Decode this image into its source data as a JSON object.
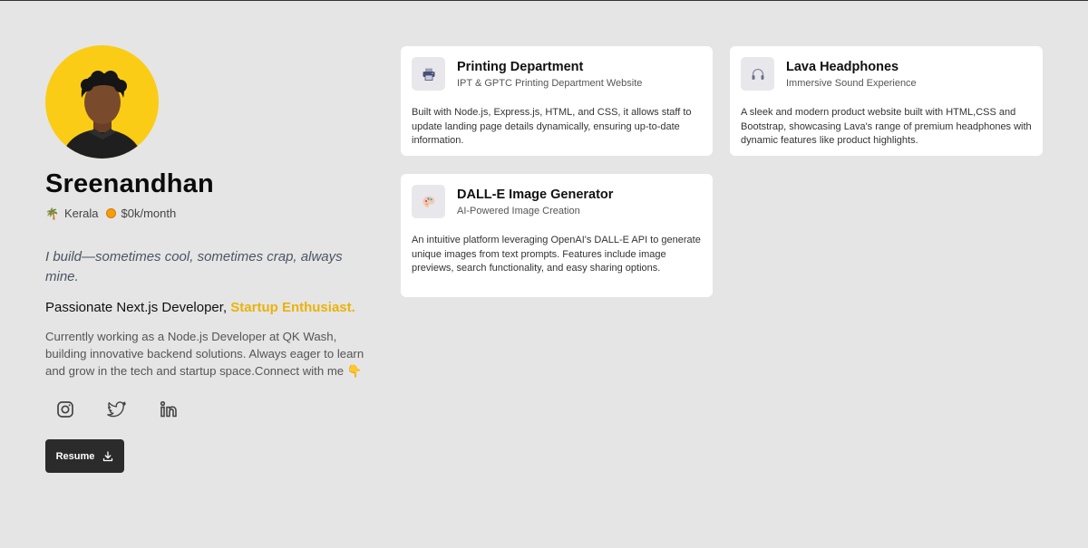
{
  "profile": {
    "name": "Sreenandhan",
    "location_emoji": "🌴",
    "location": "Kerala",
    "income": "$0k/month",
    "tagline": "I build—sometimes cool, sometimes crap, always mine.",
    "role_prefix": "Passionate Next.js Developer,",
    "role_accent": "Startup Enthusiast.",
    "bio": "Currently working as a Node.js Developer at QK Wash, building innovative backend solutions. Always eager to learn and grow in the tech and startup space.Connect with me 👇",
    "socials": [
      "instagram-icon",
      "twitter-icon",
      "linkedin-icon"
    ],
    "resume_label": "Resume",
    "accent_color": "#eab308",
    "avatar_bg": "#facc15"
  },
  "projects": [
    {
      "title": "Printing Department",
      "subtitle": "IPT & GPTC Printing Department Website",
      "description": "Built with Node.js, Express.js, HTML, and CSS, it allows staff to update landing page details dynamically, ensuring up-to-date information.",
      "icon": "printer-icon"
    },
    {
      "title": "Lava Headphones",
      "subtitle": "Immersive Sound Experience",
      "description": "A sleek and modern product website built with HTML,CSS and Bootstrap, showcasing Lava's range of premium headphones with dynamic features like product highlights.",
      "icon": "headphones-icon"
    },
    {
      "title": "DALL-E Image Generator",
      "subtitle": "AI-Powered Image Creation",
      "description": "An intuitive platform leveraging OpenAI's DALL-E API to generate unique images from text prompts. Features include image previews, search functionality, and easy sharing options.",
      "icon": "palette-icon"
    }
  ]
}
